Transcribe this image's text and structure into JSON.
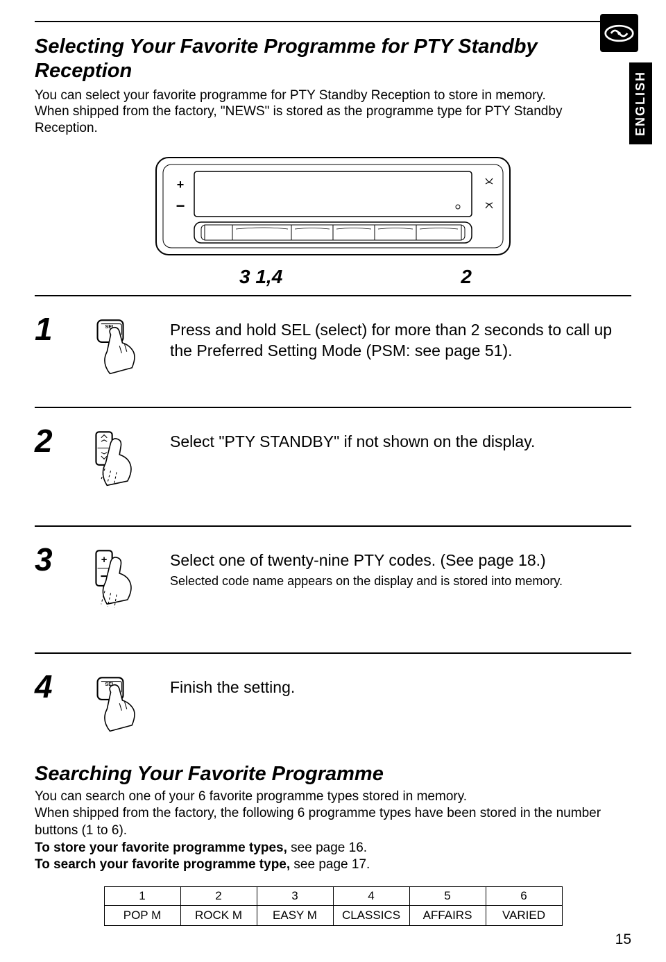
{
  "language_tab": "ENGLISH",
  "title": "Selecting Your Favorite Programme for PTY Standby Reception",
  "intro_p1": "You can select your favorite programme for PTY Standby Reception to store in memory.",
  "intro_p2": "When shipped from the factory, \"NEWS\" is stored as the programme type for PTY Standby Reception.",
  "device_numbers": {
    "left": "3 1,4",
    "right": "2"
  },
  "steps": [
    {
      "num": "1",
      "icon": "sel",
      "text": "Press and hold SEL (select) for more than 2 seconds to call up the Preferred Setting Mode (PSM: see page 51)."
    },
    {
      "num": "2",
      "icon": "updown",
      "text": "Select \"PTY STANDBY\" if not shown on the display."
    },
    {
      "num": "3",
      "icon": "plusminus",
      "text": "Select one of twenty-nine PTY codes. (See page 18.)",
      "small": "Selected code name appears on the display and is stored into memory."
    },
    {
      "num": "4",
      "icon": "sel",
      "text": "Finish the setting."
    }
  ],
  "search_title": "Searching Your Favorite Programme",
  "search_p1": "You can search one of your 6 favorite programme types stored in memory.",
  "search_p2": "When shipped from the factory, the following 6 programme types have been stored in the number buttons (1 to 6).",
  "search_p3a": "To store your favorite programme types,",
  "search_p3b": " see page 16.",
  "search_p4a": "To search your favorite programme type,",
  "search_p4b": " see page 17.",
  "preset_table": {
    "numbers": [
      "1",
      "2",
      "3",
      "4",
      "5",
      "6"
    ],
    "types": [
      "POP M",
      "ROCK M",
      "EASY M",
      "CLASSICS",
      "AFFAIRS",
      "VARIED"
    ]
  },
  "page_number": "15"
}
